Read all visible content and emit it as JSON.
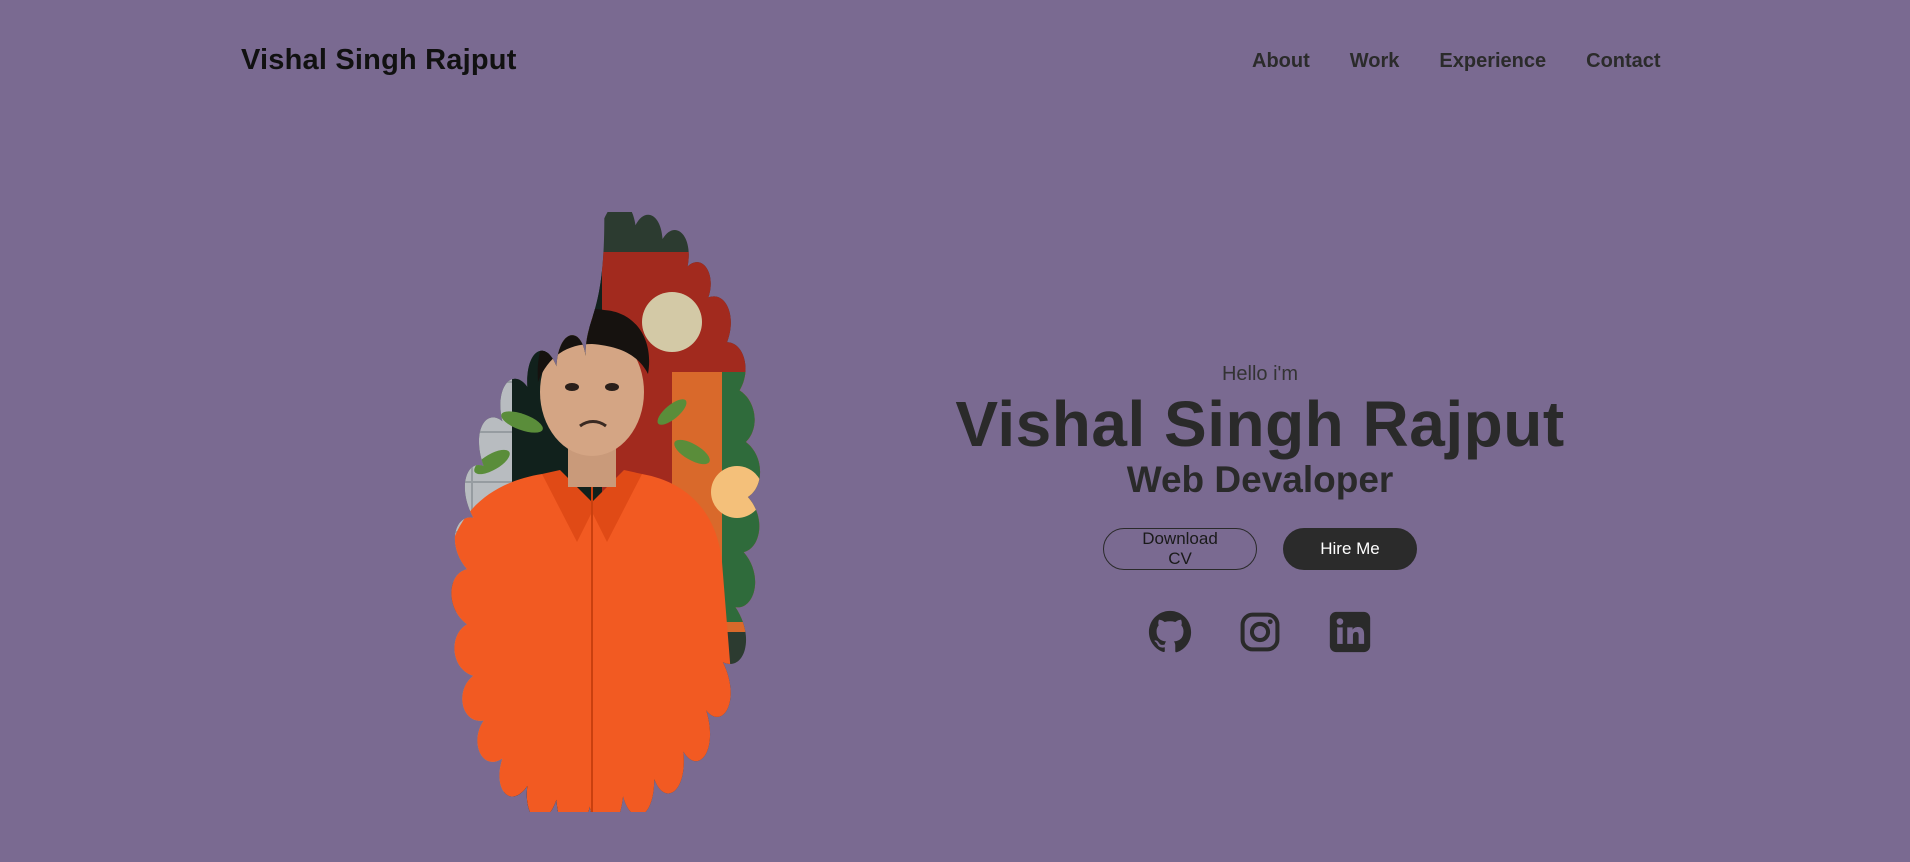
{
  "header": {
    "brand": "Vishal Singh Rajput",
    "nav": [
      {
        "label": "About"
      },
      {
        "label": "Work"
      },
      {
        "label": "Experience"
      },
      {
        "label": "Contact"
      }
    ]
  },
  "hero": {
    "greeting": "Hello i'm",
    "name": "Vishal Singh Rajput",
    "role": "Web Devaloper",
    "download_label": "Download CV",
    "hire_label": "Hire Me",
    "socials": [
      {
        "icon": "github-icon"
      },
      {
        "icon": "instagram-icon"
      },
      {
        "icon": "linkedin-icon"
      }
    ]
  },
  "colors": {
    "background": "#7a6a91",
    "text_dark": "#2a2a2a",
    "button_dark": "#2b2b2b",
    "shirt": "#f25a22"
  }
}
